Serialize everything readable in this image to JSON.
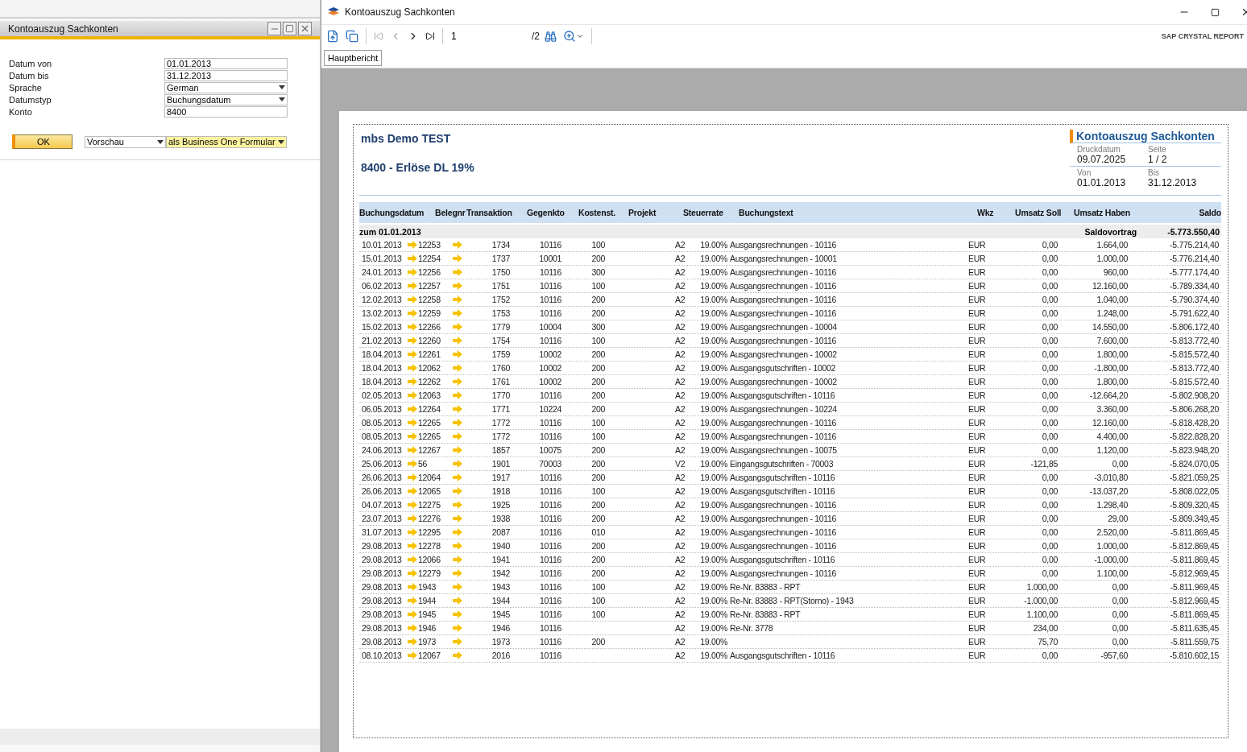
{
  "form_window": {
    "title": "Kontoauszug Sachkonten",
    "fields": [
      {
        "label": "Datum von",
        "value": "01.01.2013",
        "kind": "text"
      },
      {
        "label": "Datum bis",
        "value": "31.12.2013",
        "kind": "text"
      },
      {
        "label": "Sprache",
        "value": "German",
        "kind": "dropdown"
      },
      {
        "label": "Datumstyp",
        "value": "Buchungsdatum",
        "kind": "dropdown"
      },
      {
        "label": "Konto",
        "value": "8400",
        "kind": "text"
      }
    ],
    "ok_button": "OK",
    "output_select": "Vorschau",
    "format_select": "als Business One Formular"
  },
  "viewer": {
    "title": "Kontoauszug Sachkonten",
    "page_field": "1",
    "page_total": "/2",
    "brand": "SAP CRYSTAL REPORT",
    "tabs": [
      {
        "label": "Hauptbericht",
        "selected": true
      }
    ]
  },
  "report": {
    "company": "mbs Demo TEST",
    "account": "8400 - Erlöse DL 19%",
    "title": "Kontoauszug Sachkonten",
    "meta": [
      {
        "label": "Druckdatum",
        "value": "09.07.2025"
      },
      {
        "label": "Seite",
        "value": "1 / 2"
      },
      {
        "label": "Von",
        "value": "01.01.2013"
      },
      {
        "label": "Bis",
        "value": "31.12.2013"
      }
    ],
    "columns": [
      "Buchungsdatum",
      "Belegnr",
      "Transaktion",
      "Gegenkto",
      "Kostenst.",
      "Projekt",
      "Steuerrate",
      "Buchungstext",
      "Wkz",
      "Umsatz Soll",
      "Umsatz Haben",
      "Saldo"
    ],
    "opening": {
      "label": "zum 01.01.2013",
      "caption": "Saldovortrag",
      "saldo": "-5.773.550,40"
    },
    "rows": [
      {
        "date": "10.01.2013",
        "beleg": "12253",
        "trans": "1734",
        "gkto": "10116",
        "kst": "100",
        "code": "A2",
        "rate": "19.00%",
        "text": "Ausgangsrechnungen - 10116",
        "wkz": "EUR",
        "soll": "0,00",
        "haben": "1.664,00",
        "saldo": "-5.775.214,40"
      },
      {
        "date": "15.01.2013",
        "beleg": "12254",
        "trans": "1737",
        "gkto": "10001",
        "kst": "200",
        "code": "A2",
        "rate": "19.00%",
        "text": "Ausgangsrechnungen - 10001",
        "wkz": "EUR",
        "soll": "0,00",
        "haben": "1.000,00",
        "saldo": "-5.776.214,40"
      },
      {
        "date": "24.01.2013",
        "beleg": "12256",
        "trans": "1750",
        "gkto": "10116",
        "kst": "300",
        "code": "A2",
        "rate": "19.00%",
        "text": "Ausgangsrechnungen - 10116",
        "wkz": "EUR",
        "soll": "0,00",
        "haben": "960,00",
        "saldo": "-5.777.174,40"
      },
      {
        "date": "06.02.2013",
        "beleg": "12257",
        "trans": "1751",
        "gkto": "10116",
        "kst": "100",
        "code": "A2",
        "rate": "19.00%",
        "text": "Ausgangsrechnungen - 10116",
        "wkz": "EUR",
        "soll": "0,00",
        "haben": "12.160,00",
        "saldo": "-5.789.334,40"
      },
      {
        "date": "12.02.2013",
        "beleg": "12258",
        "trans": "1752",
        "gkto": "10116",
        "kst": "200",
        "code": "A2",
        "rate": "19.00%",
        "text": "Ausgangsrechnungen - 10116",
        "wkz": "EUR",
        "soll": "0,00",
        "haben": "1.040,00",
        "saldo": "-5.790.374,40"
      },
      {
        "date": "13.02.2013",
        "beleg": "12259",
        "trans": "1753",
        "gkto": "10116",
        "kst": "200",
        "code": "A2",
        "rate": "19.00%",
        "text": "Ausgangsrechnungen - 10116",
        "wkz": "EUR",
        "soll": "0,00",
        "haben": "1.248,00",
        "saldo": "-5.791.622,40"
      },
      {
        "date": "15.02.2013",
        "beleg": "12266",
        "trans": "1779",
        "gkto": "10004",
        "kst": "300",
        "code": "A2",
        "rate": "19.00%",
        "text": "Ausgangsrechnungen - 10004",
        "wkz": "EUR",
        "soll": "0,00",
        "haben": "14.550,00",
        "saldo": "-5.806.172,40"
      },
      {
        "date": "21.02.2013",
        "beleg": "12260",
        "trans": "1754",
        "gkto": "10116",
        "kst": "100",
        "code": "A2",
        "rate": "19.00%",
        "text": "Ausgangsrechnungen - 10116",
        "wkz": "EUR",
        "soll": "0,00",
        "haben": "7.600,00",
        "saldo": "-5.813.772,40"
      },
      {
        "date": "18.04.2013",
        "beleg": "12261",
        "trans": "1759",
        "gkto": "10002",
        "kst": "200",
        "code": "A2",
        "rate": "19.00%",
        "text": "Ausgangsrechnungen - 10002",
        "wkz": "EUR",
        "soll": "0,00",
        "haben": "1.800,00",
        "saldo": "-5.815.572,40"
      },
      {
        "date": "18.04.2013",
        "beleg": "12062",
        "trans": "1760",
        "gkto": "10002",
        "kst": "200",
        "code": "A2",
        "rate": "19.00%",
        "text": "Ausgangsgutschriften - 10002",
        "wkz": "EUR",
        "soll": "0,00",
        "haben": "-1.800,00",
        "saldo": "-5.813.772,40"
      },
      {
        "date": "18.04.2013",
        "beleg": "12262",
        "trans": "1761",
        "gkto": "10002",
        "kst": "200",
        "code": "A2",
        "rate": "19.00%",
        "text": "Ausgangsrechnungen - 10002",
        "wkz": "EUR",
        "soll": "0,00",
        "haben": "1.800,00",
        "saldo": "-5.815.572,40"
      },
      {
        "date": "02.05.2013",
        "beleg": "12063",
        "trans": "1770",
        "gkto": "10116",
        "kst": "200",
        "code": "A2",
        "rate": "19.00%",
        "text": "Ausgangsgutschriften - 10116",
        "wkz": "EUR",
        "soll": "0,00",
        "haben": "-12.664,20",
        "saldo": "-5.802.908,20"
      },
      {
        "date": "06.05.2013",
        "beleg": "12264",
        "trans": "1771",
        "gkto": "10224",
        "kst": "200",
        "code": "A2",
        "rate": "19.00%",
        "text": "Ausgangsrechnungen - 10224",
        "wkz": "EUR",
        "soll": "0,00",
        "haben": "3.360,00",
        "saldo": "-5.806.268,20"
      },
      {
        "date": "08.05.2013",
        "beleg": "12265",
        "trans": "1772",
        "gkto": "10116",
        "kst": "100",
        "code": "A2",
        "rate": "19.00%",
        "text": "Ausgangsrechnungen - 10116",
        "wkz": "EUR",
        "soll": "0,00",
        "haben": "12.160,00",
        "saldo": "-5.818.428,20"
      },
      {
        "date": "08.05.2013",
        "beleg": "12265",
        "trans": "1772",
        "gkto": "10116",
        "kst": "100",
        "code": "A2",
        "rate": "19.00%",
        "text": "Ausgangsrechnungen - 10116",
        "wkz": "EUR",
        "soll": "0,00",
        "haben": "4.400,00",
        "saldo": "-5.822.828,20"
      },
      {
        "date": "24.06.2013",
        "beleg": "12267",
        "trans": "1857",
        "gkto": "10075",
        "kst": "200",
        "code": "A2",
        "rate": "19.00%",
        "text": "Ausgangsrechnungen - 10075",
        "wkz": "EUR",
        "soll": "0,00",
        "haben": "1.120,00",
        "saldo": "-5.823.948,20"
      },
      {
        "date": "25.06.2013",
        "beleg": "56",
        "trans": "1901",
        "gkto": "70003",
        "kst": "200",
        "code": "V2",
        "rate": "19.00%",
        "text": "Eingangsgutschriften - 70003",
        "wkz": "EUR",
        "soll": "-121,85",
        "haben": "0,00",
        "saldo": "-5.824.070,05"
      },
      {
        "date": "26.06.2013",
        "beleg": "12064",
        "trans": "1917",
        "gkto": "10116",
        "kst": "200",
        "code": "A2",
        "rate": "19.00%",
        "text": "Ausgangsgutschriften - 10116",
        "wkz": "EUR",
        "soll": "0,00",
        "haben": "-3.010,80",
        "saldo": "-5.821.059,25"
      },
      {
        "date": "26.06.2013",
        "beleg": "12065",
        "trans": "1918",
        "gkto": "10116",
        "kst": "100",
        "code": "A2",
        "rate": "19.00%",
        "text": "Ausgangsgutschriften - 10116",
        "wkz": "EUR",
        "soll": "0,00",
        "haben": "-13.037,20",
        "saldo": "-5.808.022,05"
      },
      {
        "date": "04.07.2013",
        "beleg": "12275",
        "trans": "1925",
        "gkto": "10116",
        "kst": "200",
        "code": "A2",
        "rate": "19.00%",
        "text": "Ausgangsrechnungen - 10116",
        "wkz": "EUR",
        "soll": "0,00",
        "haben": "1.298,40",
        "saldo": "-5.809.320,45"
      },
      {
        "date": "23.07.2013",
        "beleg": "12276",
        "trans": "1938",
        "gkto": "10116",
        "kst": "200",
        "code": "A2",
        "rate": "19.00%",
        "text": "Ausgangsrechnungen - 10116",
        "wkz": "EUR",
        "soll": "0,00",
        "haben": "29,00",
        "saldo": "-5.809.349,45"
      },
      {
        "date": "31.07.2013",
        "beleg": "12295",
        "trans": "2087",
        "gkto": "10116",
        "kst": "010",
        "code": "A2",
        "rate": "19.00%",
        "text": "Ausgangsrechnungen - 10116",
        "wkz": "EUR",
        "soll": "0,00",
        "haben": "2.520,00",
        "saldo": "-5.811.869,45"
      },
      {
        "date": "29.08.2013",
        "beleg": "12278",
        "trans": "1940",
        "gkto": "10116",
        "kst": "200",
        "code": "A2",
        "rate": "19.00%",
        "text": "Ausgangsrechnungen - 10116",
        "wkz": "EUR",
        "soll": "0,00",
        "haben": "1.000,00",
        "saldo": "-5.812.869,45"
      },
      {
        "date": "29.08.2013",
        "beleg": "12066",
        "trans": "1941",
        "gkto": "10116",
        "kst": "200",
        "code": "A2",
        "rate": "19.00%",
        "text": "Ausgangsgutschriften - 10116",
        "wkz": "EUR",
        "soll": "0,00",
        "haben": "-1.000,00",
        "saldo": "-5.811.869,45"
      },
      {
        "date": "29.08.2013",
        "beleg": "12279",
        "trans": "1942",
        "gkto": "10116",
        "kst": "200",
        "code": "A2",
        "rate": "19.00%",
        "text": "Ausgangsrechnungen - 10116",
        "wkz": "EUR",
        "soll": "0,00",
        "haben": "1.100,00",
        "saldo": "-5.812.969,45"
      },
      {
        "date": "29.08.2013",
        "beleg": "1943",
        "trans": "1943",
        "gkto": "10116",
        "kst": "100",
        "code": "A2",
        "rate": "19.00%",
        "text": "Re-Nr. 83883 - RPT",
        "wkz": "EUR",
        "soll": "1.000,00",
        "haben": "0,00",
        "saldo": "-5.811.969,45"
      },
      {
        "date": "29.08.2013",
        "beleg": "1944",
        "trans": "1944",
        "gkto": "10116",
        "kst": "100",
        "code": "A2",
        "rate": "19.00%",
        "text": "Re-Nr. 83883 - RPT(Storno) - 1943",
        "wkz": "EUR",
        "soll": "-1.000,00",
        "haben": "0,00",
        "saldo": "-5.812.969,45"
      },
      {
        "date": "29.08.2013",
        "beleg": "1945",
        "trans": "1945",
        "gkto": "10116",
        "kst": "100",
        "code": "A2",
        "rate": "19.00%",
        "text": "Re-Nr. 83883 - RPT",
        "wkz": "EUR",
        "soll": "1.100,00",
        "haben": "0,00",
        "saldo": "-5.811.869,45"
      },
      {
        "date": "29.08.2013",
        "beleg": "1946",
        "trans": "1946",
        "gkto": "10116",
        "code": "A2",
        "rate": "19.00%",
        "text": "Re-Nr. 3778",
        "wkz": "EUR",
        "soll": "234,00",
        "haben": "0,00",
        "saldo": "-5.811.635,45"
      },
      {
        "date": "29.08.2013",
        "beleg": "1973",
        "trans": "1973",
        "gkto": "10116",
        "kst": "200",
        "code": "A2",
        "rate": "19.00%",
        "wkz": "EUR",
        "soll": "75,70",
        "haben": "0,00",
        "saldo": "-5.811.559,75"
      },
      {
        "date": "08.10.2013",
        "beleg": "12067",
        "trans": "2016",
        "gkto": "10116",
        "code": "A2",
        "rate": "19.00%",
        "text": "Ausgangsgutschriften - 10116",
        "wkz": "EUR",
        "soll": "0,00",
        "haben": "-957,60",
        "saldo": "-5.810.602,15"
      }
    ]
  }
}
